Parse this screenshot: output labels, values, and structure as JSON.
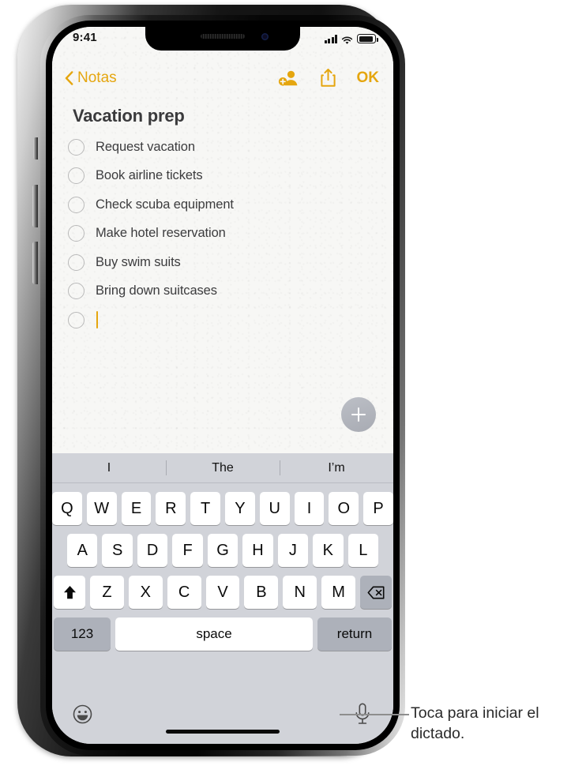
{
  "status_bar": {
    "time": "9:41",
    "icons": [
      "cellular-signal-icon",
      "wifi-icon",
      "battery-icon"
    ]
  },
  "nav_bar": {
    "back_label": "Notas",
    "back_icon": "chevron-left-icon",
    "collaborate_icon": "add-person-icon",
    "share_icon": "share-icon",
    "done_label": "OK",
    "accent_color": "#E5A60F"
  },
  "note": {
    "title": "Vacation prep",
    "checklist": [
      {
        "text": "Request vacation",
        "checked": false
      },
      {
        "text": "Book airline tickets",
        "checked": false
      },
      {
        "text": "Check scuba equipment",
        "checked": false
      },
      {
        "text": "Make hotel reservation",
        "checked": false
      },
      {
        "text": "Buy swim suits",
        "checked": false
      },
      {
        "text": "Bring down suitcases",
        "checked": false
      },
      {
        "text": "",
        "checked": false,
        "active": true
      }
    ],
    "paper_color": "#F7F7F5",
    "title_color": "#3A3A3C"
  },
  "floating_button": {
    "icon": "plus-icon",
    "color": "#B0B3BB"
  },
  "keyboard": {
    "background_color": "#D1D3D9",
    "key_color": "#FFFFFF",
    "modifier_key_color": "#ADB1BA",
    "predictions": [
      "I",
      "The",
      "I’m"
    ],
    "row1": [
      "Q",
      "W",
      "E",
      "R",
      "T",
      "Y",
      "U",
      "I",
      "O",
      "P"
    ],
    "row2": [
      "A",
      "S",
      "D",
      "F",
      "G",
      "H",
      "J",
      "K",
      "L"
    ],
    "row3_letters": [
      "Z",
      "X",
      "C",
      "V",
      "B",
      "N",
      "M"
    ],
    "shift_icon": "shift-up-arrow-icon",
    "delete_icon": "backspace-delete-icon",
    "numbers_label": "123",
    "space_label": "space",
    "return_label": "return",
    "emoji_icon": "emoji-smiley-icon",
    "dictation_icon": "microphone-icon"
  },
  "callout": {
    "text": "Toca para iniciar el dictado."
  }
}
